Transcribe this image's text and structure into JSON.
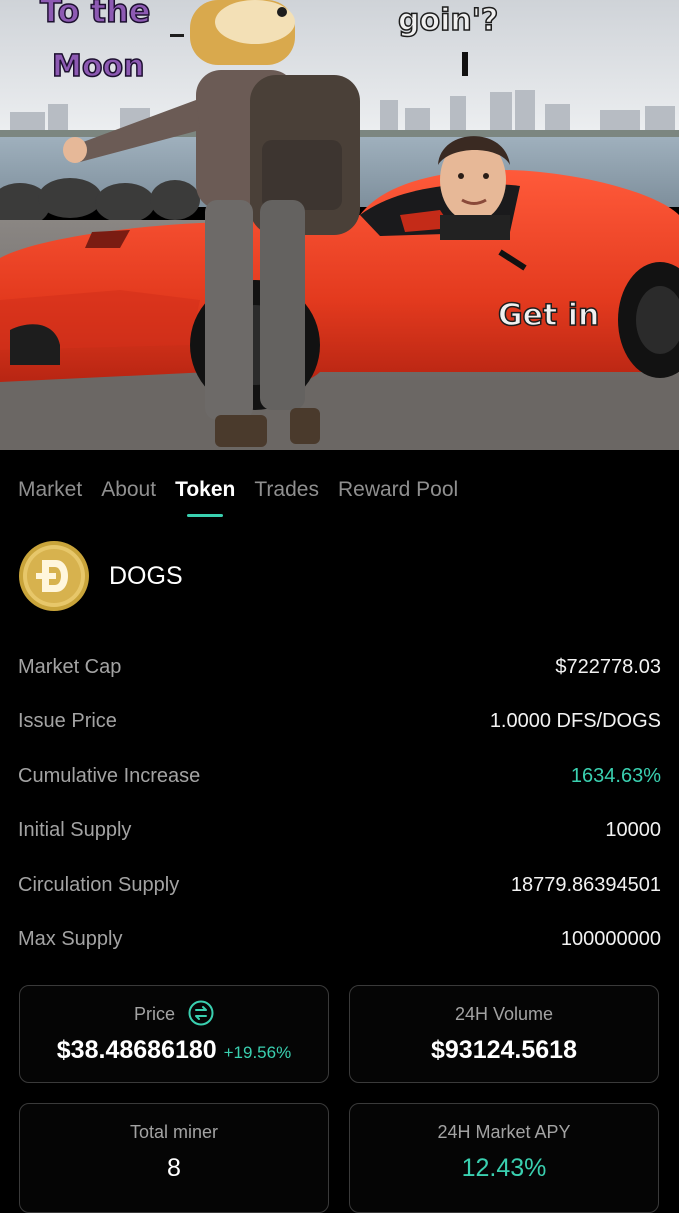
{
  "banner": {
    "text_top_left": [
      "To the",
      "Moon"
    ],
    "text_top_center": "goin'?",
    "text_car": "Get in"
  },
  "tabs": [
    {
      "label": "Market",
      "active": false
    },
    {
      "label": "About",
      "active": false
    },
    {
      "label": "Token",
      "active": true
    },
    {
      "label": "Trades",
      "active": false
    },
    {
      "label": "Reward Pool",
      "active": false
    }
  ],
  "token": {
    "name": "DOGS",
    "logo_icon": "doge-coin-icon"
  },
  "stats": [
    {
      "label": "Market Cap",
      "value": "$722778.03"
    },
    {
      "label": "Issue Price",
      "value": "1.0000 DFS/DOGS"
    },
    {
      "label": "Cumulative Increase",
      "value": "1634.63%"
    },
    {
      "label": "Initial Supply",
      "value": "10000"
    },
    {
      "label": "Circulation Supply",
      "value": "18779.86394501"
    },
    {
      "label": "Max Supply",
      "value": "100000000"
    }
  ],
  "cards": {
    "price": {
      "label": "Price",
      "value": "$38.48686180",
      "change": "+19.56%"
    },
    "volume": {
      "label": "24H Volume",
      "value": "$93124.5618"
    },
    "miners": {
      "label": "Total miner",
      "value": "8"
    },
    "apy": {
      "label": "24H Market APY",
      "value": "12.43%"
    }
  },
  "colors": {
    "accent": "#3ad0b0",
    "background": "#000000",
    "car": "#e8371f"
  }
}
